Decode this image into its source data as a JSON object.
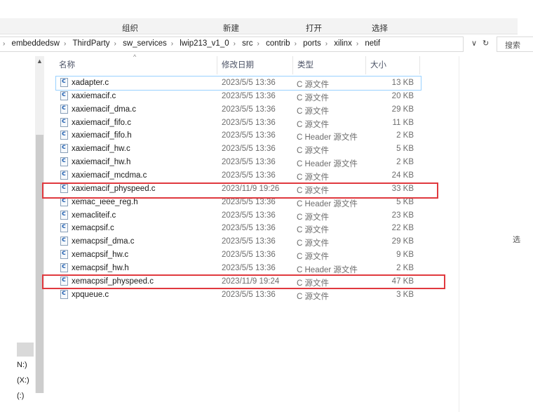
{
  "ribbon": {
    "organize": "组织",
    "new": "新建",
    "open": "打开",
    "select": "选择"
  },
  "address": {
    "lead_sep": "›",
    "crumbs": [
      "embeddedsw",
      "ThirdParty",
      "sw_services",
      "lwip213_v1_0",
      "src",
      "contrib",
      "ports",
      "xilinx",
      "netif"
    ],
    "sep": "›",
    "dropdown_glyph": "∨",
    "refresh_glyph": "↻",
    "search_placeholder": "搜索"
  },
  "nav": {
    "items": [
      "N:)",
      "(X:)",
      "(:)"
    ],
    "up_glyph": "▲"
  },
  "columns": {
    "name": "名称",
    "date": "修改日期",
    "type": "类型",
    "size": "大小",
    "sort_glyph": "^"
  },
  "files": [
    {
      "name": "xadapter.c",
      "date": "2023/5/5 13:36",
      "type": "C 源文件",
      "size": "13 KB"
    },
    {
      "name": "xaxiemacif.c",
      "date": "2023/5/5 13:36",
      "type": "C 源文件",
      "size": "20 KB"
    },
    {
      "name": "xaxiemacif_dma.c",
      "date": "2023/5/5 13:36",
      "type": "C 源文件",
      "size": "29 KB"
    },
    {
      "name": "xaxiemacif_fifo.c",
      "date": "2023/5/5 13:36",
      "type": "C 源文件",
      "size": "11 KB"
    },
    {
      "name": "xaxiemacif_fifo.h",
      "date": "2023/5/5 13:36",
      "type": "C Header 源文件",
      "size": "2 KB"
    },
    {
      "name": "xaxiemacif_hw.c",
      "date": "2023/5/5 13:36",
      "type": "C 源文件",
      "size": "5 KB"
    },
    {
      "name": "xaxiemacif_hw.h",
      "date": "2023/5/5 13:36",
      "type": "C Header 源文件",
      "size": "2 KB"
    },
    {
      "name": "xaxiemacif_mcdma.c",
      "date": "2023/5/5 13:36",
      "type": "C 源文件",
      "size": "24 KB"
    },
    {
      "name": "xaxiemacif_physpeed.c",
      "date": "2023/11/9 19:26",
      "type": "C 源文件",
      "size": "33 KB"
    },
    {
      "name": "xemac_ieee_reg.h",
      "date": "2023/5/5 13:36",
      "type": "C Header 源文件",
      "size": "5 KB"
    },
    {
      "name": "xemacliteif.c",
      "date": "2023/5/5 13:36",
      "type": "C 源文件",
      "size": "23 KB"
    },
    {
      "name": "xemacpsif.c",
      "date": "2023/5/5 13:36",
      "type": "C 源文件",
      "size": "22 KB"
    },
    {
      "name": "xemacpsif_dma.c",
      "date": "2023/5/5 13:36",
      "type": "C 源文件",
      "size": "29 KB"
    },
    {
      "name": "xemacpsif_hw.c",
      "date": "2023/5/5 13:36",
      "type": "C 源文件",
      "size": "9 KB"
    },
    {
      "name": "xemacpsif_hw.h",
      "date": "2023/5/5 13:36",
      "type": "C Header 源文件",
      "size": "2 KB"
    },
    {
      "name": "xemacpsif_physpeed.c",
      "date": "2023/11/9 19:24",
      "type": "C 源文件",
      "size": "47 KB"
    },
    {
      "name": "xpqueue.c",
      "date": "2023/5/5 13:36",
      "type": "C 源文件",
      "size": "3 KB"
    }
  ],
  "right_pane": {
    "text": "选"
  },
  "highlight_color": "#e0393e"
}
